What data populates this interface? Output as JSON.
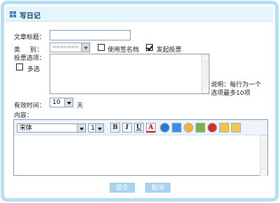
{
  "header": {
    "title": "写日记"
  },
  "form": {
    "title_label": "文章标题：",
    "title_value": "",
    "category_label": "类    别：",
    "category_value": "=======",
    "use_signature_label": "使用签名档",
    "use_signature_checked": false,
    "start_poll_label": "发起投票",
    "start_poll_checked": true,
    "poll_options_label": "投票选项：",
    "multi_select_label": "多选",
    "multi_select_checked": false,
    "poll_note_line1": "说明：每行为一个",
    "poll_note_line2": "选项最多10项",
    "valid_time_label": "有效时间：",
    "valid_time_value": "10",
    "valid_time_unit": "天",
    "content_label": "内容："
  },
  "editor": {
    "font_value": "宋体",
    "size_value": "1",
    "tools": [
      "bold-icon",
      "italic-icon",
      "underline-icon",
      "font-color-icon",
      "globe-link-icon",
      "refresh-icon",
      "emoticon-icon",
      "image-icon",
      "flash-icon",
      "media-icon",
      "note-icon"
    ],
    "bold": "B",
    "italic": "I",
    "underline": "U",
    "font_color": "A"
  },
  "buttons": {
    "submit": "提交",
    "cancel": "取消"
  },
  "colors": {
    "border": "#b7dff4",
    "header_bg": "#e6f4fc",
    "title": "#0b3f78",
    "button": "#a9d4ee"
  }
}
